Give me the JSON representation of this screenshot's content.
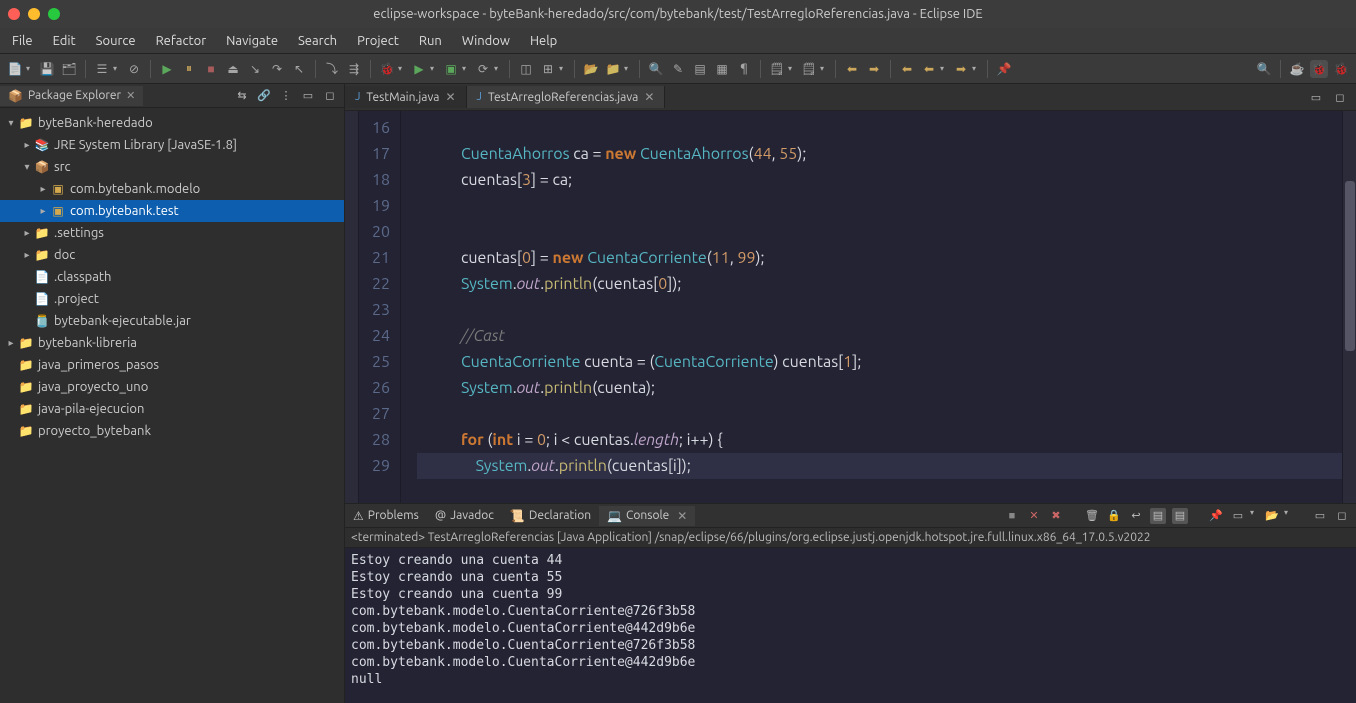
{
  "title": "eclipse-workspace - byteBank-heredado/src/com/bytebank/test/TestArregloReferencias.java - Eclipse IDE",
  "menu": [
    "File",
    "Edit",
    "Source",
    "Refactor",
    "Navigate",
    "Search",
    "Project",
    "Run",
    "Window",
    "Help"
  ],
  "package_explorer": {
    "title": "Package Explorer",
    "tree": [
      {
        "depth": 0,
        "arrow": "▾",
        "icon": "proj",
        "label": "byteBank-heredado"
      },
      {
        "depth": 1,
        "arrow": "▸",
        "icon": "jre",
        "label": "JRE System Library [JavaSE-1.8]"
      },
      {
        "depth": 1,
        "arrow": "▾",
        "icon": "src",
        "label": "src"
      },
      {
        "depth": 2,
        "arrow": "▸",
        "icon": "pkg",
        "label": "com.bytebank.modelo"
      },
      {
        "depth": 2,
        "arrow": "▸",
        "icon": "pkg",
        "label": "com.bytebank.test",
        "selected": true
      },
      {
        "depth": 1,
        "arrow": "▸",
        "icon": "folder",
        "label": ".settings"
      },
      {
        "depth": 1,
        "arrow": "▸",
        "icon": "folder",
        "label": "doc"
      },
      {
        "depth": 1,
        "arrow": "",
        "icon": "file",
        "label": ".classpath"
      },
      {
        "depth": 1,
        "arrow": "",
        "icon": "file",
        "label": ".project"
      },
      {
        "depth": 1,
        "arrow": "",
        "icon": "jar",
        "label": "bytebank-ejecutable.jar"
      },
      {
        "depth": 0,
        "arrow": "▸",
        "icon": "proj",
        "label": "bytebank-libreria"
      },
      {
        "depth": 0,
        "arrow": "",
        "icon": "proj",
        "label": "java_primeros_pasos"
      },
      {
        "depth": 0,
        "arrow": "",
        "icon": "proj",
        "label": "java_proyecto_uno"
      },
      {
        "depth": 0,
        "arrow": "",
        "icon": "proj",
        "label": "java-pila-ejecucion"
      },
      {
        "depth": 0,
        "arrow": "",
        "icon": "proj",
        "label": "proyecto_bytebank"
      }
    ]
  },
  "editor": {
    "tabs": [
      {
        "label": "TestMain.java",
        "active": false
      },
      {
        "label": "TestArregloReferencias.java",
        "active": true
      }
    ],
    "first_line": 16,
    "lines": [
      {
        "tokens": []
      },
      {
        "tokens": [
          {
            "c": "type",
            "t": "CuentaAhorros"
          },
          {
            "c": "punct",
            "t": " ca "
          },
          {
            "c": "punct",
            "t": "= "
          },
          {
            "c": "kw",
            "t": "new"
          },
          {
            "c": "punct",
            "t": " "
          },
          {
            "c": "type",
            "t": "CuentaAhorros"
          },
          {
            "c": "punct",
            "t": "("
          },
          {
            "c": "num",
            "t": "44"
          },
          {
            "c": "punct",
            "t": ", "
          },
          {
            "c": "num",
            "t": "55"
          },
          {
            "c": "punct",
            "t": ");"
          }
        ],
        "indent": 3
      },
      {
        "tokens": [
          {
            "c": "punct",
            "t": "cuentas["
          },
          {
            "c": "num",
            "t": "3"
          },
          {
            "c": "punct",
            "t": "] = ca;"
          }
        ],
        "indent": 3
      },
      {
        "tokens": []
      },
      {
        "tokens": []
      },
      {
        "tokens": [
          {
            "c": "punct",
            "t": "cuentas["
          },
          {
            "c": "num",
            "t": "0"
          },
          {
            "c": "punct",
            "t": "] = "
          },
          {
            "c": "kw",
            "t": "new"
          },
          {
            "c": "punct",
            "t": " "
          },
          {
            "c": "type",
            "t": "CuentaCorriente"
          },
          {
            "c": "punct",
            "t": "("
          },
          {
            "c": "num",
            "t": "11"
          },
          {
            "c": "punct",
            "t": ", "
          },
          {
            "c": "num",
            "t": "99"
          },
          {
            "c": "punct",
            "t": ");"
          }
        ],
        "indent": 3
      },
      {
        "tokens": [
          {
            "c": "type",
            "t": "System"
          },
          {
            "c": "punct",
            "t": "."
          },
          {
            "c": "field",
            "t": "out"
          },
          {
            "c": "punct",
            "t": "."
          },
          {
            "c": "fn",
            "t": "println"
          },
          {
            "c": "punct",
            "t": "(cuentas["
          },
          {
            "c": "num",
            "t": "0"
          },
          {
            "c": "punct",
            "t": "]);"
          }
        ],
        "indent": 3
      },
      {
        "tokens": []
      },
      {
        "tokens": [
          {
            "c": "cmt",
            "t": "//Cast"
          }
        ],
        "indent": 3
      },
      {
        "tokens": [
          {
            "c": "type",
            "t": "CuentaCorriente"
          },
          {
            "c": "punct",
            "t": " cuenta = ("
          },
          {
            "c": "type",
            "t": "CuentaCorriente"
          },
          {
            "c": "punct",
            "t": ") cuentas["
          },
          {
            "c": "num",
            "t": "1"
          },
          {
            "c": "punct",
            "t": "];"
          }
        ],
        "indent": 3
      },
      {
        "tokens": [
          {
            "c": "type",
            "t": "System"
          },
          {
            "c": "punct",
            "t": "."
          },
          {
            "c": "field",
            "t": "out"
          },
          {
            "c": "punct",
            "t": "."
          },
          {
            "c": "fn",
            "t": "println"
          },
          {
            "c": "punct",
            "t": "(cuenta);"
          }
        ],
        "indent": 3
      },
      {
        "tokens": []
      },
      {
        "tokens": [
          {
            "c": "kw",
            "t": "for"
          },
          {
            "c": "punct",
            "t": " ("
          },
          {
            "c": "kw",
            "t": "int"
          },
          {
            "c": "punct",
            "t": " i = "
          },
          {
            "c": "num",
            "t": "0"
          },
          {
            "c": "punct",
            "t": "; i < cuentas."
          },
          {
            "c": "field",
            "t": "length"
          },
          {
            "c": "punct",
            "t": "; i++) {"
          }
        ],
        "indent": 3
      },
      {
        "tokens": [
          {
            "c": "type",
            "t": "System"
          },
          {
            "c": "punct",
            "t": "."
          },
          {
            "c": "field",
            "t": "out"
          },
          {
            "c": "punct",
            "t": "."
          },
          {
            "c": "fn",
            "t": "println"
          },
          {
            "c": "punct",
            "t": "(cuentas[i]);"
          }
        ],
        "indent": 4,
        "hl": true
      }
    ]
  },
  "bottom": {
    "tabs": [
      "Problems",
      "Javadoc",
      "Declaration",
      "Console"
    ],
    "active": 3,
    "header": "<terminated> TestArregloReferencias [Java Application] /snap/eclipse/66/plugins/org.eclipse.justj.openjdk.hotspot.jre.full.linux.x86_64_17.0.5.v2022",
    "output": "Estoy creando una cuenta 44\nEstoy creando una cuenta 55\nEstoy creando una cuenta 99\ncom.bytebank.modelo.CuentaCorriente@726f3b58\ncom.bytebank.modelo.CuentaCorriente@442d9b6e\ncom.bytebank.modelo.CuentaCorriente@726f3b58\ncom.bytebank.modelo.CuentaCorriente@442d9b6e\nnull"
  }
}
